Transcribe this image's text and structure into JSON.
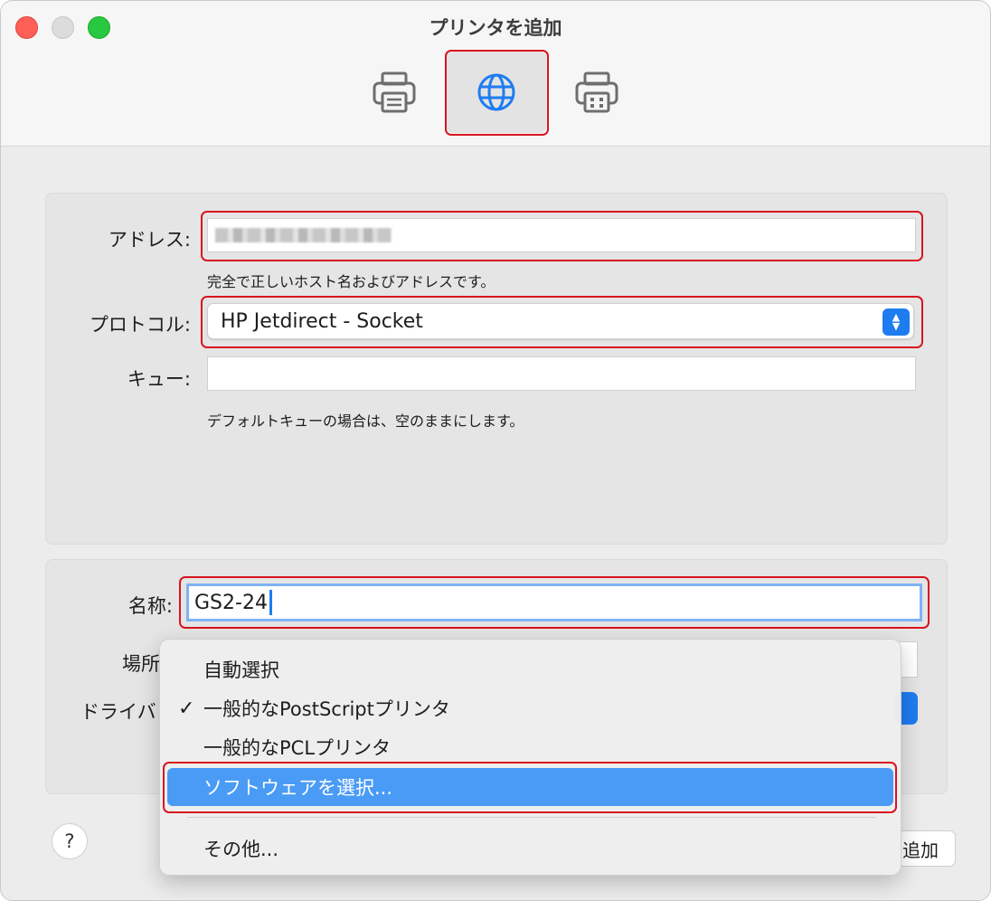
{
  "window": {
    "title": "プリンタを追加"
  },
  "toolbar": {
    "items": [
      {
        "icon": "printer-icon",
        "selected": false
      },
      {
        "icon": "globe-icon",
        "selected": true
      },
      {
        "icon": "windows-printer-icon",
        "selected": false
      }
    ]
  },
  "form": {
    "address_label": "アドレス:",
    "address_hint": "完全で正しいホスト名およびアドレスです。",
    "protocol_label": "プロトコル:",
    "protocol_value": "HP Jetdirect - Socket",
    "queue_label": "キュー:",
    "queue_value": "",
    "queue_hint": "デフォルトキューの場合は、空のままにします。",
    "name_label": "名称:",
    "name_value": "GS2-24",
    "location_label": "場所",
    "driver_label": "ドライバ",
    "add_button": "追加"
  },
  "help_button": "?",
  "menu": {
    "items": [
      {
        "label": "自動選択",
        "checked": false,
        "selected": false
      },
      {
        "label": "一般的なPostScriptプリンタ",
        "checked": true,
        "selected": false
      },
      {
        "label": "一般的なPCLプリンタ",
        "checked": false,
        "selected": false
      },
      {
        "label": "ソフトウェアを選択...",
        "checked": false,
        "selected": true
      },
      {
        "label": "その他...",
        "checked": false,
        "selected": false
      }
    ],
    "check_glyph": "✓"
  },
  "colors": {
    "highlight_red": "#d9141e",
    "accent_blue": "#1e7cf1",
    "menu_selected": "#4a9bf5"
  }
}
